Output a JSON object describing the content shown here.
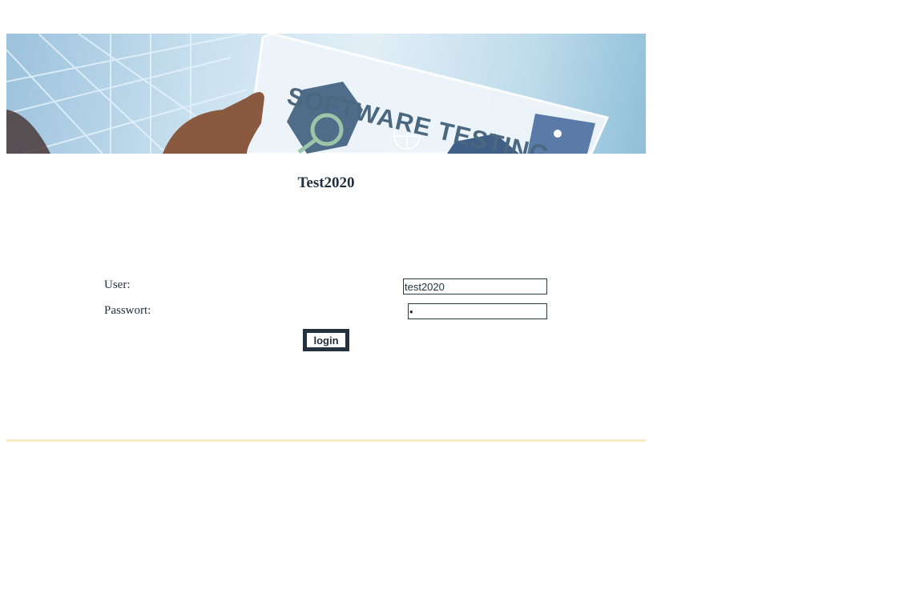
{
  "banner": {
    "text": "SOFTWARE TESTING",
    "alt": "Software testing banner"
  },
  "page": {
    "title": "Test2020"
  },
  "login_form": {
    "user_label": "User:",
    "user_value": "test2020",
    "password_label": "Passwort:",
    "password_value": "•",
    "submit_label": "login"
  },
  "colors": {
    "text": "#1f2f3d",
    "button_border": "#243240",
    "footer_rule": "#f6edc4"
  }
}
